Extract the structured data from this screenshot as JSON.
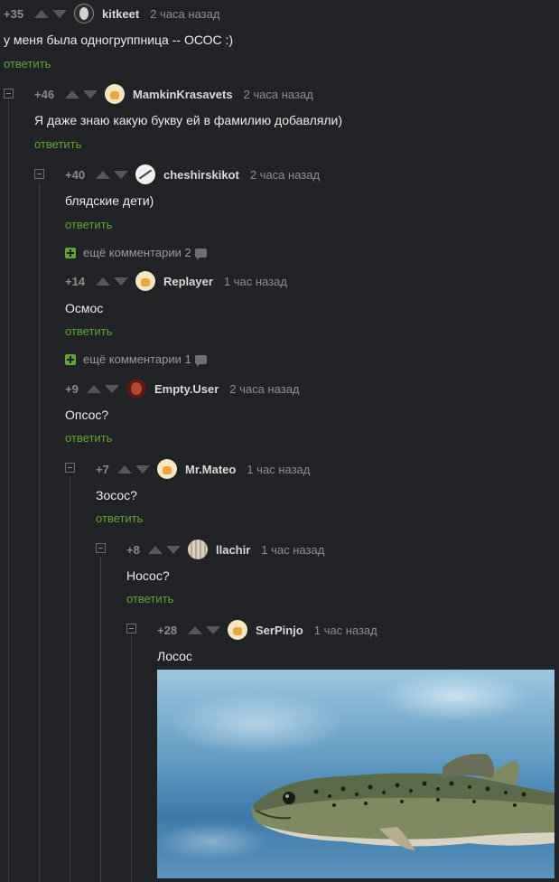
{
  "comments": [
    {
      "id": "c1",
      "score": "+35",
      "author": "kitkeet",
      "time": "2 часа назад",
      "text": "у меня была одногруппница -- ОСОС :)",
      "reply": "ответить",
      "avatar": "dark-portrait-avatar"
    },
    {
      "id": "c2",
      "score": "+46",
      "author": "MamkinKrasavets",
      "time": "2 часа назад",
      "text": "Я даже знаю какую букву ей в фамилию добавляли)",
      "reply": "ответить",
      "avatar": "default-avatar"
    },
    {
      "id": "c3",
      "score": "+40",
      "author": "cheshirskikot",
      "time": "2 часа назад",
      "text": "блядские дети)",
      "reply": "ответить",
      "avatar": "white-avatar"
    },
    {
      "id": "c4",
      "score": "+14",
      "author": "Replayer",
      "time": "1 час назад",
      "text": "Осмос",
      "reply": "ответить",
      "avatar": "default-avatar"
    },
    {
      "id": "c5",
      "score": "+9",
      "author": "Empty.User",
      "time": "2 часа назад",
      "text": "Опсос?",
      "reply": "ответить",
      "avatar": "red-portrait-avatar"
    },
    {
      "id": "c6",
      "score": "+7",
      "author": "Mr.Mateo",
      "time": "1 час назад",
      "text": "Зосос?",
      "reply": "ответить",
      "avatar": "default-avatar"
    },
    {
      "id": "c7",
      "score": "+8",
      "author": "llachir",
      "time": "1 час назад",
      "text": "Носос?",
      "reply": "ответить",
      "avatar": "pattern-avatar"
    },
    {
      "id": "c8",
      "score": "+28",
      "author": "SerPinjo",
      "time": "1 час назад",
      "text": "Лосос",
      "reply": "",
      "avatar": "default-avatar"
    }
  ],
  "more_comments": [
    {
      "label": "ещё комментарии 2"
    },
    {
      "label": "ещё комментарии 1"
    }
  ],
  "image": {
    "subject": "salmon-photo"
  },
  "colors": {
    "background": "#222326",
    "reply": "#5ea831",
    "plus": "#5ea831",
    "text": "#ececec",
    "meta": "#8f8f8f"
  }
}
